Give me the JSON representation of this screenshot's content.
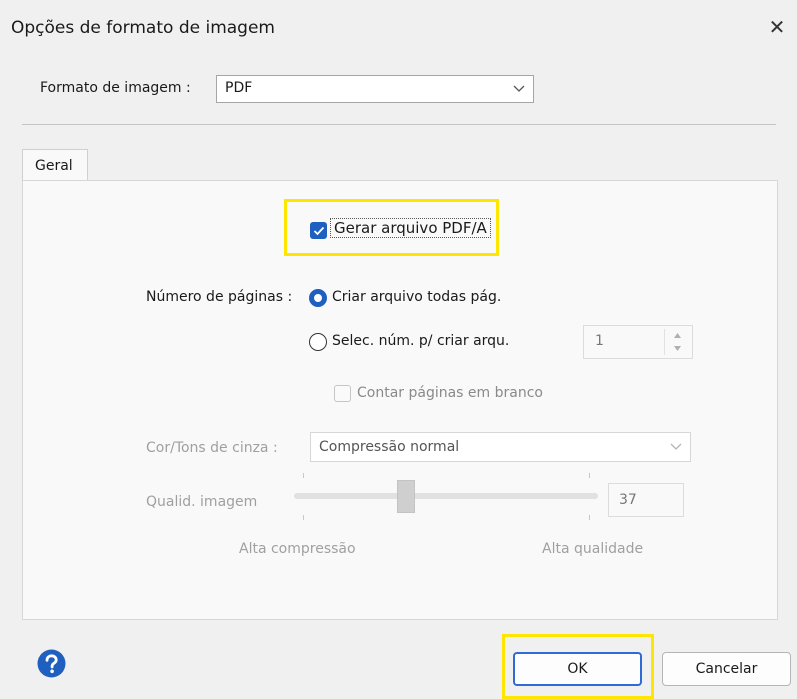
{
  "window": {
    "title": "Opções de formato de imagem",
    "close_glyph": "✕"
  },
  "format": {
    "label": "Formato de imagem :",
    "value": "PDF"
  },
  "tabs": [
    {
      "label": "Geral",
      "active": true
    }
  ],
  "pdfa": {
    "label": "Gerar arquivo PDF/A",
    "checked": true
  },
  "pages": {
    "label": "Número de páginas :",
    "option_all": "Criar arquivo todas pág.",
    "option_select": "Selec. núm. p/ criar arqu.",
    "selected": "all",
    "count_value": "1"
  },
  "blank_pages": {
    "label": "Contar páginas em branco",
    "checked": false,
    "disabled": true
  },
  "color": {
    "label": "Cor/Tons de cinza :",
    "value": "Compressão normal"
  },
  "quality": {
    "label": "Qualid. imagem",
    "value": "37",
    "min_label": "Alta compressão",
    "max_label": "Alta qualidade"
  },
  "buttons": {
    "ok": "OK",
    "cancel": "Cancelar"
  },
  "colors": {
    "accent": "#1f5fbf",
    "highlight": "#ffe600",
    "help_icon": "#1f5fbf"
  },
  "icons": {
    "close": "close-icon",
    "chevron": "chevron-down-icon",
    "check": "checkmark-icon",
    "help": "help-icon"
  }
}
